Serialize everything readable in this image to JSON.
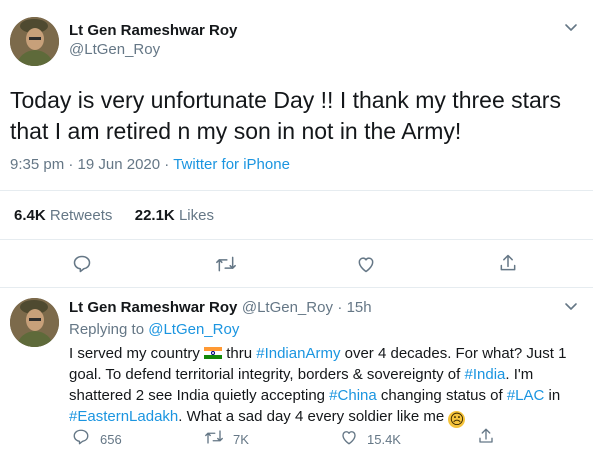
{
  "tweet": {
    "author_name": "Lt Gen Rameshwar Roy",
    "author_handle": "@LtGen_Roy",
    "text_line1": "Today is very unfortunate Day !!   I thank my three stars",
    "text_line2": "that I am retired n my son in not in the Army!",
    "time": "9:35 pm",
    "date": "19 Jun 2020",
    "source": "Twitter for iPhone",
    "retweets_count": "6.4K",
    "retweets_label": "Retweets",
    "likes_count": "22.1K",
    "likes_label": "Likes",
    "menu_icon": "chevron-down-icon"
  },
  "reply": {
    "author_name": "Lt Gen Rameshwar Roy",
    "author_handle": "@LtGen_Roy",
    "age": "15h",
    "replying_to_label": "Replying to",
    "replying_to_handle": "@LtGen_Roy",
    "segments": {
      "s1": "I served my country ",
      "s2": " thru ",
      "tag1": "#IndianArmy",
      "s3": " over 4 decades. For what? Just 1 goal. To defend territorial integrity, borders & sovereignty of ",
      "tag2": "#India",
      "s4": ". I'm shattered 2 see India quietly accepting ",
      "tag3": "#China",
      "s5": " changing status of ",
      "tag4": "#LAC",
      "s6": " in ",
      "tag5": "#EasternLadakh",
      "s7": ". What a sad day 4 every soldier like me "
    },
    "flag_emoji": "🇮🇳",
    "sad_emoji": "☹",
    "replies": "656",
    "retweets": "7K",
    "likes": "15.4K"
  },
  "colors": {
    "link": "#1b95e0",
    "muted": "#657786",
    "divider": "#e6ecf0"
  }
}
